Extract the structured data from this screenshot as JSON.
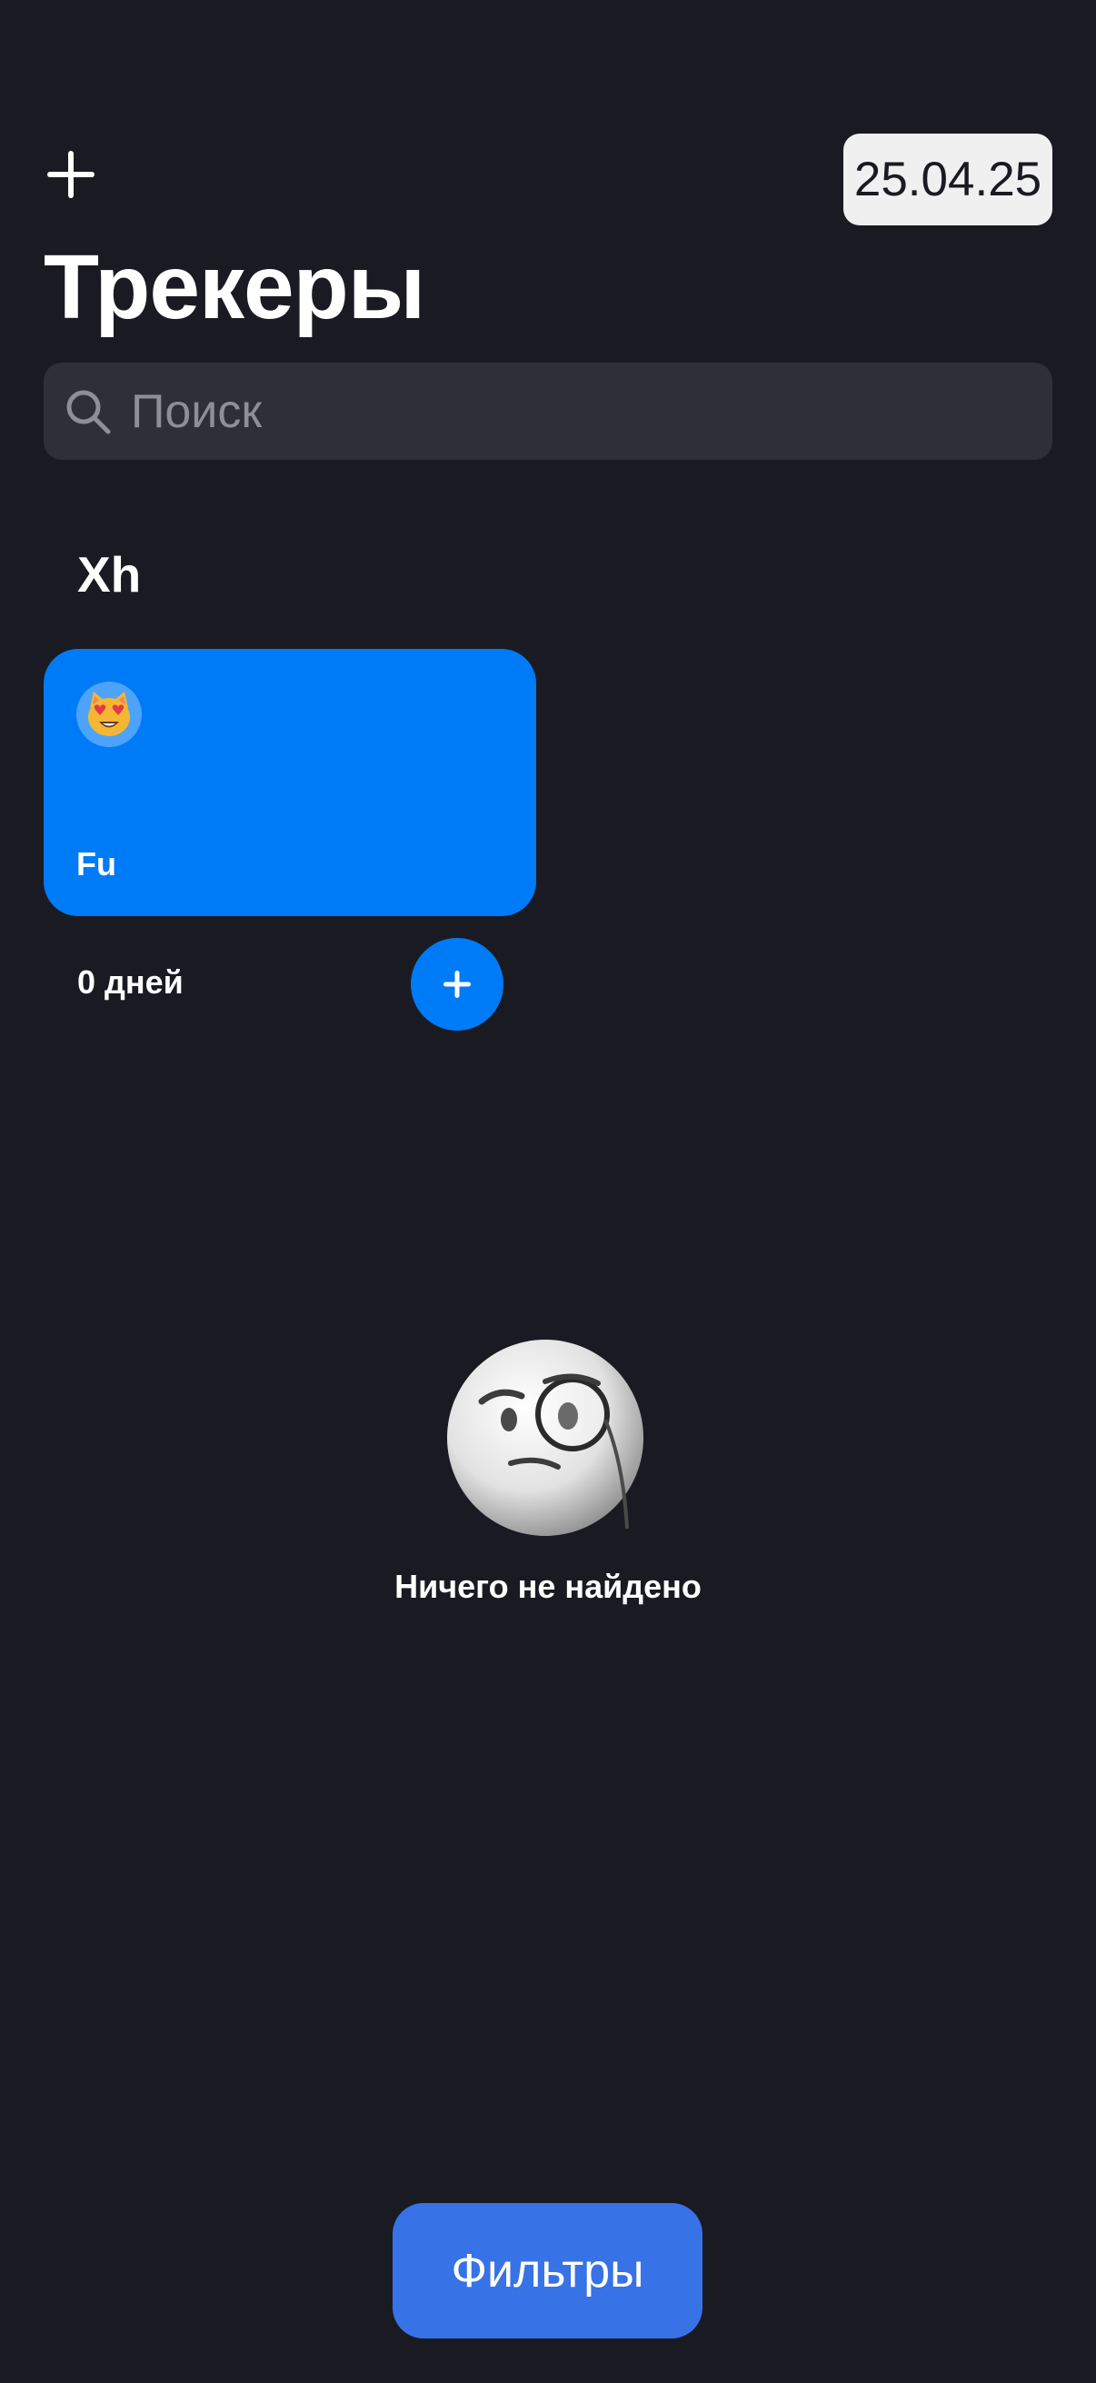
{
  "header": {
    "add_icon": "plus-icon",
    "date": "25.04.25"
  },
  "title": "Трекеры",
  "search": {
    "placeholder": "Поиск",
    "value": "",
    "icon": "search-icon"
  },
  "categories": [
    {
      "title": "Xh",
      "trackers": [
        {
          "emoji": "😻",
          "name": "Fu",
          "days": "0 дней",
          "color": "#007BF7",
          "action_icon": "plus-icon"
        }
      ]
    }
  ],
  "empty_state": {
    "icon": "monocle-face-emoji",
    "text": "Ничего не найдено"
  },
  "filters_button": "Фильтры",
  "colors": {
    "background": "#1A1B22",
    "card": "#007BF7",
    "filters": "#3772E7",
    "search_bg": "#2E2F37"
  }
}
